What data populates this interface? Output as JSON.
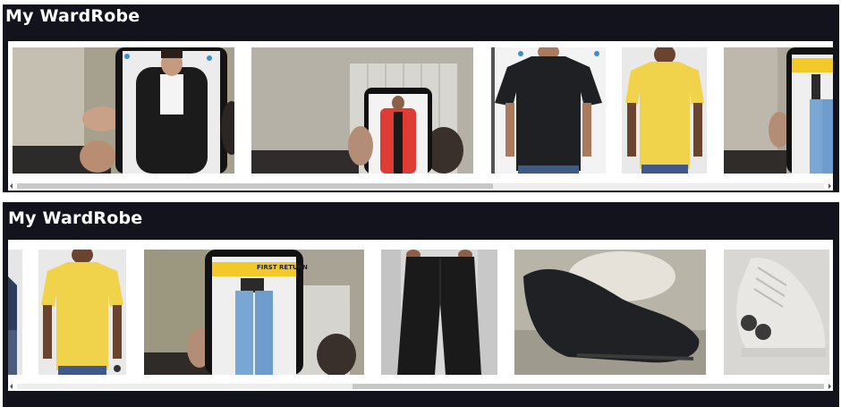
{
  "panels": [
    {
      "title": "My WardRobe",
      "items": [
        {
          "icon": "phone-leather-jacket-photo"
        },
        {
          "icon": "phone-red-jacket-photo"
        },
        {
          "icon": "black-tshirt-photo"
        },
        {
          "icon": "yellow-tshirt-photo"
        },
        {
          "icon": "phone-jeans-photo"
        }
      ],
      "scroll_position": 0.0
    },
    {
      "title": "My WardRobe",
      "items": [
        {
          "icon": "partial-photo"
        },
        {
          "icon": "yellow-tshirt-photo"
        },
        {
          "icon": "phone-jeans-photo",
          "banner_text": "FIRST RETURN"
        },
        {
          "icon": "black-pants-photo"
        },
        {
          "icon": "black-sneaker-photo"
        },
        {
          "icon": "white-roller-shoe-photo"
        }
      ],
      "scroll_position": 0.55
    }
  ],
  "colors": {
    "header": "#12131c",
    "strip_bg": "#ffffff",
    "scroll_thumb": "#c8c8c8",
    "banner_yellow": "#f2c928"
  }
}
